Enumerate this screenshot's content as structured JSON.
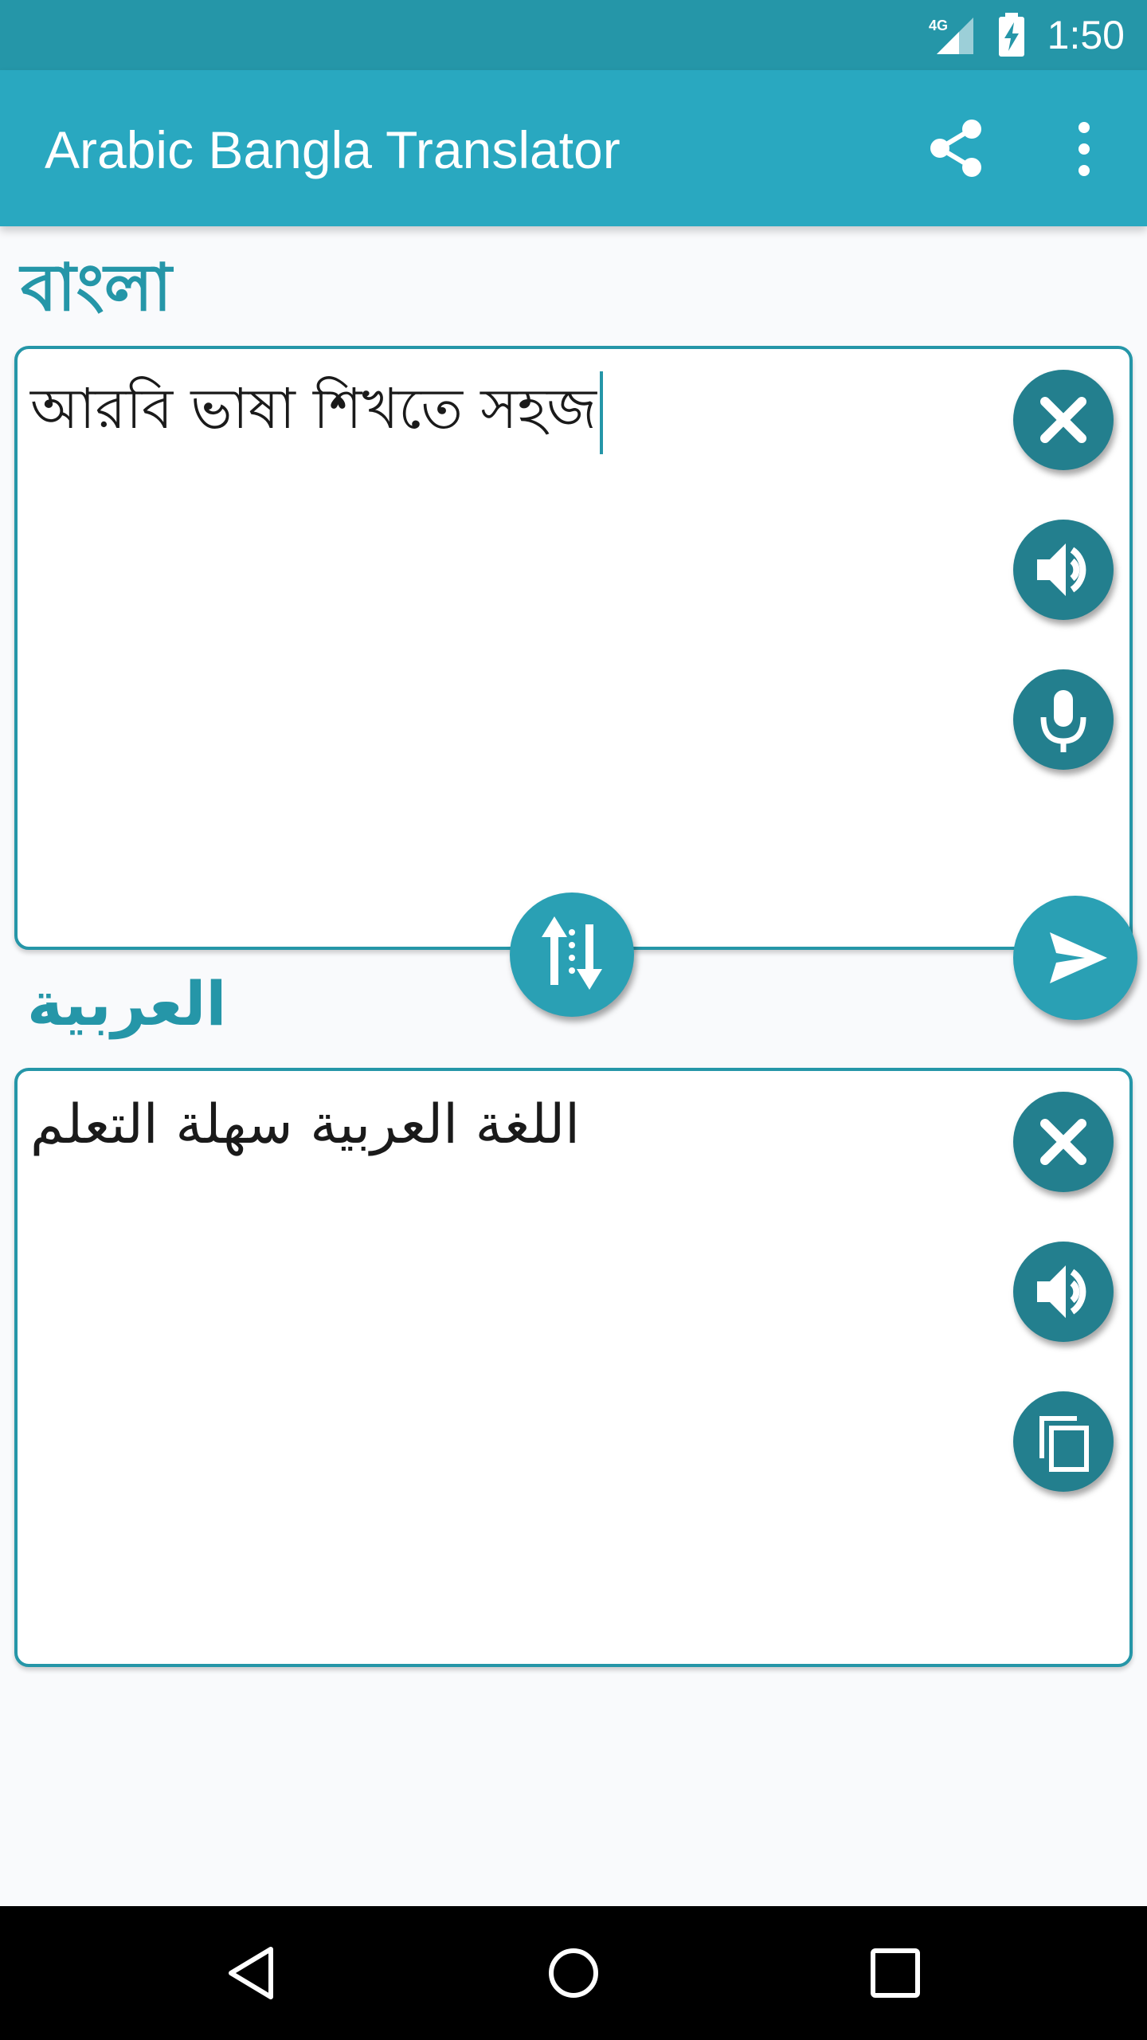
{
  "status_bar": {
    "network": "4G",
    "time": "1:50"
  },
  "app_bar": {
    "title": "Arabic Bangla Translator",
    "icons": [
      "share-icon",
      "more-vert-icon"
    ]
  },
  "source": {
    "language_label": "বাংলা",
    "text": "আরবি ভাষা শিখতে সহজ",
    "actions": [
      "clear-icon",
      "speaker-icon",
      "microphone-icon"
    ]
  },
  "controls": {
    "swap_icon": "swap-vertical-icon",
    "translate_icon": "send-icon"
  },
  "target": {
    "language_label": "العربية",
    "text": "اللغة العربية سهلة التعلم",
    "actions": [
      "clear-icon",
      "speaker-icon",
      "copy-icon"
    ]
  },
  "nav_bar": {
    "icons": [
      "back-icon",
      "home-icon",
      "recents-icon"
    ]
  },
  "colors": {
    "status_bar": "#2596a8",
    "app_bar": "#29a8c0",
    "accent": "#2596a8",
    "fab_dark": "#237f8e",
    "fab_light": "#2aa0b4",
    "background": "#f9fafc"
  }
}
